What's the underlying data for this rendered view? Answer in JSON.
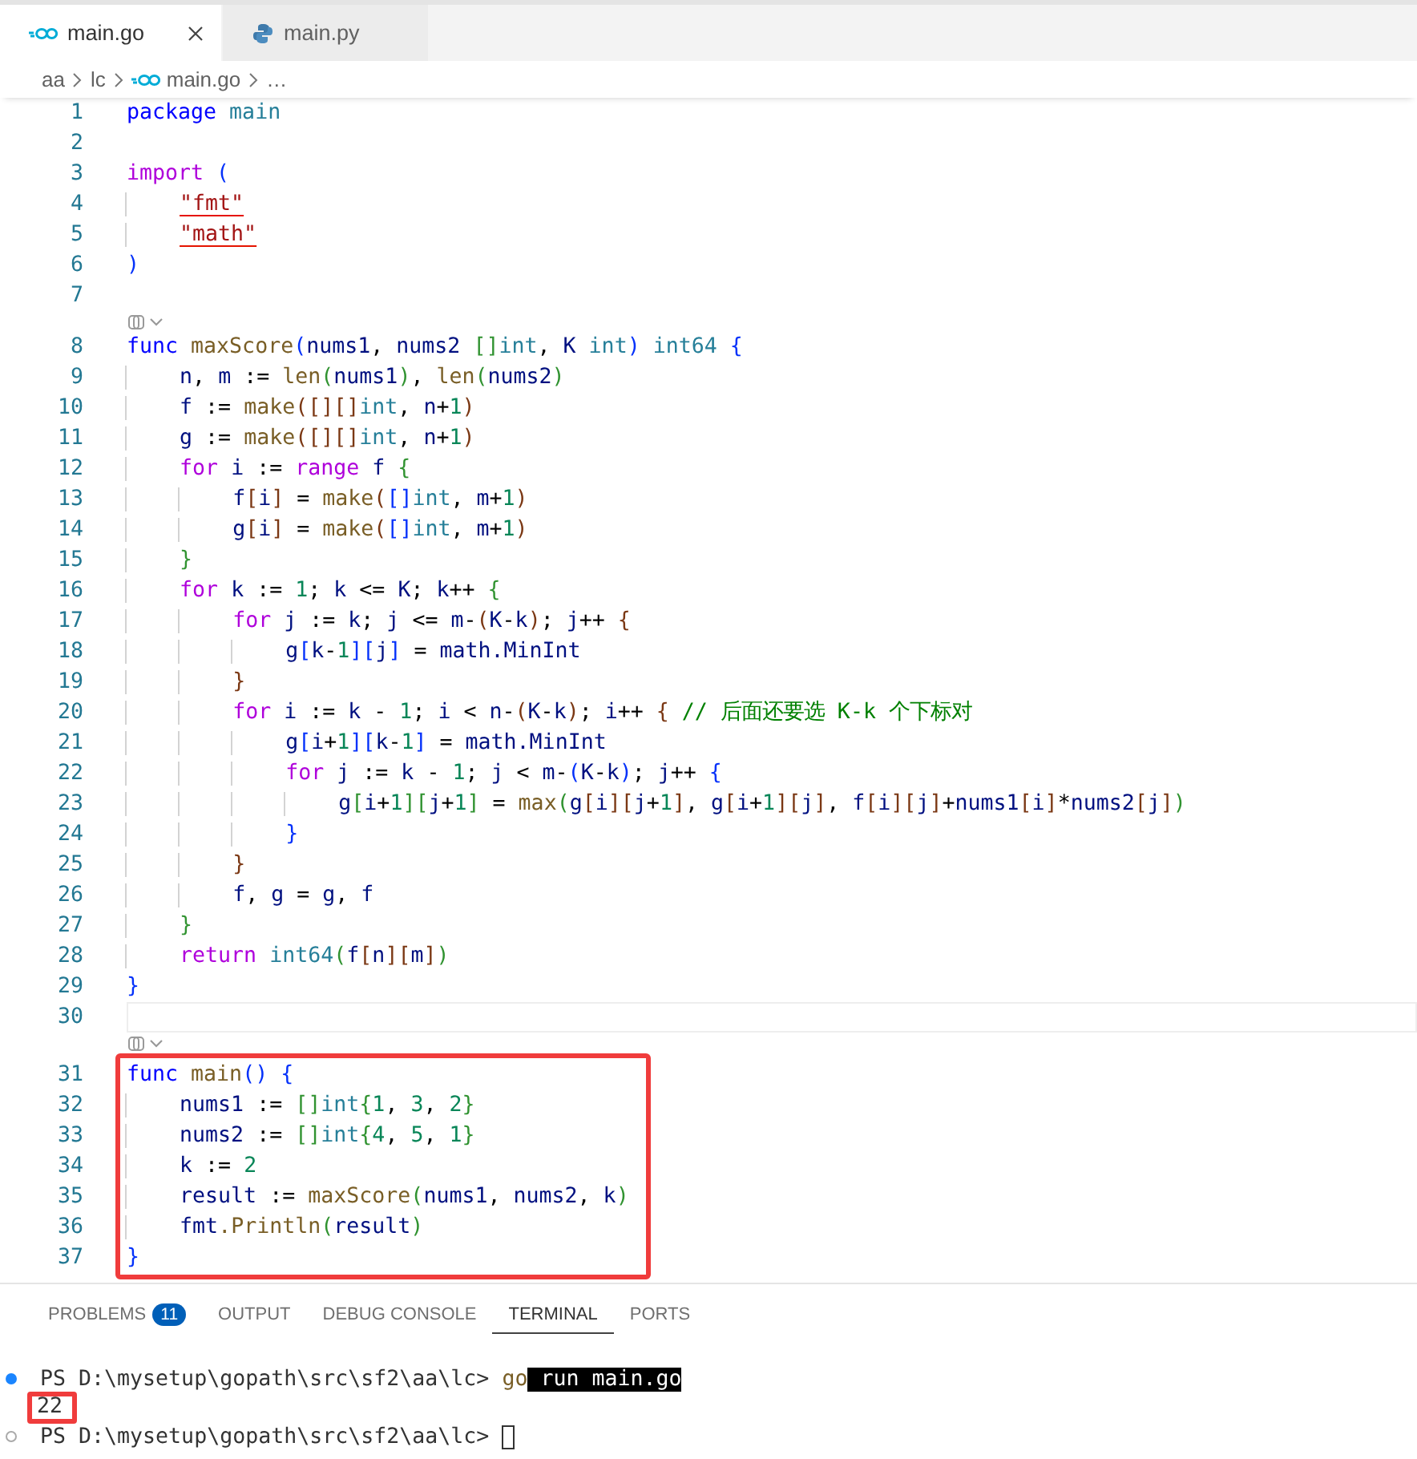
{
  "tabs": [
    {
      "label": "main.go",
      "selected": true,
      "kind": "go"
    },
    {
      "label": "main.py",
      "selected": false,
      "kind": "python"
    }
  ],
  "breadcrumb": [
    {
      "text": "aa",
      "kind": "folder"
    },
    {
      "text": "lc",
      "kind": "folder"
    },
    {
      "text": "main.go",
      "kind": "go"
    },
    {
      "text": "…",
      "kind": "more"
    }
  ],
  "editor": {
    "lines": [
      {
        "kind": "code",
        "number": "1",
        "tokens": [
          {
            "kind": "kw",
            "text": "package"
          },
          {
            "kind": "type",
            "text": " main"
          }
        ]
      },
      {
        "kind": "code",
        "number": "2"
      },
      {
        "kind": "code",
        "number": "3",
        "tokens": [
          {
            "kind": "ctrl",
            "text": "import"
          },
          {
            "kind": "b1",
            "text": " ("
          }
        ]
      },
      {
        "kind": "code",
        "number": "4",
        "tokens": [
          {
            "kind": "str",
            "text": "    \"fmt\"",
            "error": true
          }
        ]
      },
      {
        "kind": "code",
        "number": "5",
        "tokens": [
          {
            "kind": "str",
            "text": "    \"math\"",
            "error": true
          }
        ]
      },
      {
        "kind": "code",
        "number": "6",
        "tokens": [
          {
            "kind": "b1",
            "text": ")"
          }
        ]
      },
      {
        "kind": "code",
        "number": "7"
      },
      {
        "kind": "codelens"
      },
      {
        "kind": "code",
        "number": "8",
        "tokens": [
          {
            "kind": "kw",
            "text": "func"
          },
          {
            "kind": "fn",
            "text": " maxScore"
          },
          {
            "kind": "b1",
            "text": "("
          },
          {
            "kind": "var",
            "text": "nums1"
          },
          {
            "kind": "plain",
            "text": ","
          },
          {
            "kind": "var",
            "text": " nums2"
          },
          {
            "kind": "b2",
            "text": " []"
          },
          {
            "kind": "type",
            "text": "int"
          },
          {
            "kind": "plain",
            "text": ","
          },
          {
            "kind": "var",
            "text": " K"
          },
          {
            "kind": "type",
            "text": " int"
          },
          {
            "kind": "b1",
            "text": ")"
          },
          {
            "kind": "type",
            "text": " int64"
          },
          {
            "kind": "b1",
            "text": " {"
          }
        ]
      },
      {
        "kind": "code",
        "number": "9",
        "tokens": [
          {
            "kind": "var",
            "text": "    n"
          },
          {
            "kind": "plain",
            "text": ","
          },
          {
            "kind": "var",
            "text": " m"
          },
          {
            "kind": "plain",
            "text": " :="
          },
          {
            "kind": "fn",
            "text": " len"
          },
          {
            "kind": "b2",
            "text": "("
          },
          {
            "kind": "var",
            "text": "nums1"
          },
          {
            "kind": "b2",
            "text": ")"
          },
          {
            "kind": "plain",
            "text": ","
          },
          {
            "kind": "fn",
            "text": " len"
          },
          {
            "kind": "b2",
            "text": "("
          },
          {
            "kind": "var",
            "text": "nums2"
          },
          {
            "kind": "b2",
            "text": ")"
          }
        ]
      },
      {
        "kind": "code",
        "number": "10",
        "tokens": [
          {
            "kind": "var",
            "text": "    f"
          },
          {
            "kind": "plain",
            "text": " :="
          },
          {
            "kind": "fn",
            "text": " make"
          },
          {
            "kind": "b3",
            "text": "([][]"
          },
          {
            "kind": "type",
            "text": "int"
          },
          {
            "kind": "plain",
            "text": ","
          },
          {
            "kind": "var",
            "text": " n"
          },
          {
            "kind": "plain",
            "text": "+"
          },
          {
            "kind": "num",
            "text": "1"
          },
          {
            "kind": "b3",
            "text": ")"
          }
        ]
      },
      {
        "kind": "code",
        "number": "11",
        "tokens": [
          {
            "kind": "var",
            "text": "    g"
          },
          {
            "kind": "plain",
            "text": " :="
          },
          {
            "kind": "fn",
            "text": " make"
          },
          {
            "kind": "b3",
            "text": "([][]"
          },
          {
            "kind": "type",
            "text": "int"
          },
          {
            "kind": "plain",
            "text": ","
          },
          {
            "kind": "var",
            "text": " n"
          },
          {
            "kind": "plain",
            "text": "+"
          },
          {
            "kind": "num",
            "text": "1"
          },
          {
            "kind": "b3",
            "text": ")"
          }
        ]
      },
      {
        "kind": "code",
        "number": "12",
        "tokens": [
          {
            "kind": "ctrl",
            "text": "    for"
          },
          {
            "kind": "var",
            "text": " i"
          },
          {
            "kind": "plain",
            "text": " :="
          },
          {
            "kind": "ctrl",
            "text": " range"
          },
          {
            "kind": "var",
            "text": " f"
          },
          {
            "kind": "b2",
            "text": " {"
          }
        ]
      },
      {
        "kind": "code",
        "number": "13",
        "tokens": [
          {
            "kind": "var",
            "text": "        f"
          },
          {
            "kind": "b3",
            "text": "["
          },
          {
            "kind": "var",
            "text": "i"
          },
          {
            "kind": "b3",
            "text": "]"
          },
          {
            "kind": "plain",
            "text": " ="
          },
          {
            "kind": "fn",
            "text": " make"
          },
          {
            "kind": "b3",
            "text": "("
          },
          {
            "kind": "b1",
            "text": "[]"
          },
          {
            "kind": "type",
            "text": "int"
          },
          {
            "kind": "plain",
            "text": ","
          },
          {
            "kind": "var",
            "text": " m"
          },
          {
            "kind": "plain",
            "text": "+"
          },
          {
            "kind": "num",
            "text": "1"
          },
          {
            "kind": "b3",
            "text": ")"
          }
        ]
      },
      {
        "kind": "code",
        "number": "14",
        "tokens": [
          {
            "kind": "var",
            "text": "        g"
          },
          {
            "kind": "b3",
            "text": "["
          },
          {
            "kind": "var",
            "text": "i"
          },
          {
            "kind": "b3",
            "text": "]"
          },
          {
            "kind": "plain",
            "text": " ="
          },
          {
            "kind": "fn",
            "text": " make"
          },
          {
            "kind": "b3",
            "text": "("
          },
          {
            "kind": "b1",
            "text": "[]"
          },
          {
            "kind": "type",
            "text": "int"
          },
          {
            "kind": "plain",
            "text": ","
          },
          {
            "kind": "var",
            "text": " m"
          },
          {
            "kind": "plain",
            "text": "+"
          },
          {
            "kind": "num",
            "text": "1"
          },
          {
            "kind": "b3",
            "text": ")"
          }
        ]
      },
      {
        "kind": "code",
        "number": "15",
        "tokens": [
          {
            "kind": "b2",
            "text": "    }"
          }
        ]
      },
      {
        "kind": "code",
        "number": "16",
        "tokens": [
          {
            "kind": "ctrl",
            "text": "    for"
          },
          {
            "kind": "var",
            "text": " k"
          },
          {
            "kind": "plain",
            "text": " :="
          },
          {
            "kind": "num",
            "text": " 1"
          },
          {
            "kind": "plain",
            "text": ";"
          },
          {
            "kind": "var",
            "text": " k"
          },
          {
            "kind": "plain",
            "text": " <="
          },
          {
            "kind": "var",
            "text": " K"
          },
          {
            "kind": "plain",
            "text": ";"
          },
          {
            "kind": "var",
            "text": " k"
          },
          {
            "kind": "plain",
            "text": "++"
          },
          {
            "kind": "b2",
            "text": " {"
          }
        ]
      },
      {
        "kind": "code",
        "number": "17",
        "tokens": [
          {
            "kind": "ctrl",
            "text": "        for"
          },
          {
            "kind": "var",
            "text": " j"
          },
          {
            "kind": "plain",
            "text": " :="
          },
          {
            "kind": "var",
            "text": " k"
          },
          {
            "kind": "plain",
            "text": ";"
          },
          {
            "kind": "var",
            "text": " j"
          },
          {
            "kind": "plain",
            "text": " <="
          },
          {
            "kind": "var",
            "text": " m"
          },
          {
            "kind": "plain",
            "text": "-"
          },
          {
            "kind": "b3",
            "text": "("
          },
          {
            "kind": "var",
            "text": "K"
          },
          {
            "kind": "plain",
            "text": "-"
          },
          {
            "kind": "var",
            "text": "k"
          },
          {
            "kind": "b3",
            "text": ")"
          },
          {
            "kind": "plain",
            "text": ";"
          },
          {
            "kind": "var",
            "text": " j"
          },
          {
            "kind": "plain",
            "text": "++"
          },
          {
            "kind": "b3",
            "text": " {"
          }
        ]
      },
      {
        "kind": "code",
        "number": "18",
        "tokens": [
          {
            "kind": "var",
            "text": "            g"
          },
          {
            "kind": "b1",
            "text": "["
          },
          {
            "kind": "var",
            "text": "k"
          },
          {
            "kind": "plain",
            "text": "-"
          },
          {
            "kind": "num",
            "text": "1"
          },
          {
            "kind": "b1",
            "text": "]["
          },
          {
            "kind": "var",
            "text": "j"
          },
          {
            "kind": "b1",
            "text": "]"
          },
          {
            "kind": "plain",
            "text": " ="
          },
          {
            "kind": "var",
            "text": " math"
          },
          {
            "kind": "var",
            "text": ".MinInt"
          }
        ]
      },
      {
        "kind": "code",
        "number": "19",
        "tokens": [
          {
            "kind": "b3",
            "text": "        }"
          }
        ]
      },
      {
        "kind": "code",
        "number": "20",
        "tokens": [
          {
            "kind": "ctrl",
            "text": "        for"
          },
          {
            "kind": "var",
            "text": " i"
          },
          {
            "kind": "plain",
            "text": " :="
          },
          {
            "kind": "var",
            "text": " k"
          },
          {
            "kind": "plain",
            "text": " -"
          },
          {
            "kind": "num",
            "text": " 1"
          },
          {
            "kind": "plain",
            "text": ";"
          },
          {
            "kind": "var",
            "text": " i"
          },
          {
            "kind": "plain",
            "text": " <"
          },
          {
            "kind": "var",
            "text": " n"
          },
          {
            "kind": "plain",
            "text": "-"
          },
          {
            "kind": "b3",
            "text": "("
          },
          {
            "kind": "var",
            "text": "K"
          },
          {
            "kind": "plain",
            "text": "-"
          },
          {
            "kind": "var",
            "text": "k"
          },
          {
            "kind": "b3",
            "text": ")"
          },
          {
            "kind": "plain",
            "text": ";"
          },
          {
            "kind": "var",
            "text": " i"
          },
          {
            "kind": "plain",
            "text": "++"
          },
          {
            "kind": "b3",
            "text": " {"
          },
          {
            "kind": "comment",
            "text": " // 后面还要选 K-k 个下标对"
          }
        ]
      },
      {
        "kind": "code",
        "number": "21",
        "tokens": [
          {
            "kind": "var",
            "text": "            g"
          },
          {
            "kind": "b1",
            "text": "["
          },
          {
            "kind": "var",
            "text": "i"
          },
          {
            "kind": "plain",
            "text": "+"
          },
          {
            "kind": "num",
            "text": "1"
          },
          {
            "kind": "b1",
            "text": "]["
          },
          {
            "kind": "var",
            "text": "k"
          },
          {
            "kind": "plain",
            "text": "-"
          },
          {
            "kind": "num",
            "text": "1"
          },
          {
            "kind": "b1",
            "text": "]"
          },
          {
            "kind": "plain",
            "text": " ="
          },
          {
            "kind": "var",
            "text": " math"
          },
          {
            "kind": "var",
            "text": ".MinInt"
          }
        ]
      },
      {
        "kind": "code",
        "number": "22",
        "tokens": [
          {
            "kind": "ctrl",
            "text": "            for"
          },
          {
            "kind": "var",
            "text": " j"
          },
          {
            "kind": "plain",
            "text": " :="
          },
          {
            "kind": "var",
            "text": " k"
          },
          {
            "kind": "plain",
            "text": " -"
          },
          {
            "kind": "num",
            "text": " 1"
          },
          {
            "kind": "plain",
            "text": ";"
          },
          {
            "kind": "var",
            "text": " j"
          },
          {
            "kind": "plain",
            "text": " <"
          },
          {
            "kind": "var",
            "text": " m"
          },
          {
            "kind": "plain",
            "text": "-"
          },
          {
            "kind": "b1",
            "text": "("
          },
          {
            "kind": "var",
            "text": "K"
          },
          {
            "kind": "plain",
            "text": "-"
          },
          {
            "kind": "var",
            "text": "k"
          },
          {
            "kind": "b1",
            "text": ")"
          },
          {
            "kind": "plain",
            "text": ";"
          },
          {
            "kind": "var",
            "text": " j"
          },
          {
            "kind": "plain",
            "text": "++"
          },
          {
            "kind": "b1",
            "text": " {"
          }
        ]
      },
      {
        "kind": "code",
        "number": "23",
        "tokens": [
          {
            "kind": "var",
            "text": "                g"
          },
          {
            "kind": "b2",
            "text": "["
          },
          {
            "kind": "var",
            "text": "i"
          },
          {
            "kind": "plain",
            "text": "+"
          },
          {
            "kind": "num",
            "text": "1"
          },
          {
            "kind": "b2",
            "text": "]["
          },
          {
            "kind": "var",
            "text": "j"
          },
          {
            "kind": "plain",
            "text": "+"
          },
          {
            "kind": "num",
            "text": "1"
          },
          {
            "kind": "b2",
            "text": "]"
          },
          {
            "kind": "plain",
            "text": " ="
          },
          {
            "kind": "fn",
            "text": " max"
          },
          {
            "kind": "b2",
            "text": "("
          },
          {
            "kind": "var",
            "text": "g"
          },
          {
            "kind": "b3",
            "text": "["
          },
          {
            "kind": "var",
            "text": "i"
          },
          {
            "kind": "b3",
            "text": "]["
          },
          {
            "kind": "var",
            "text": "j"
          },
          {
            "kind": "plain",
            "text": "+"
          },
          {
            "kind": "num",
            "text": "1"
          },
          {
            "kind": "b3",
            "text": "]"
          },
          {
            "kind": "plain",
            "text": ","
          },
          {
            "kind": "var",
            "text": " g"
          },
          {
            "kind": "b3",
            "text": "["
          },
          {
            "kind": "var",
            "text": "i"
          },
          {
            "kind": "plain",
            "text": "+"
          },
          {
            "kind": "num",
            "text": "1"
          },
          {
            "kind": "b3",
            "text": "]["
          },
          {
            "kind": "var",
            "text": "j"
          },
          {
            "kind": "b3",
            "text": "]"
          },
          {
            "kind": "plain",
            "text": ","
          },
          {
            "kind": "var",
            "text": " f"
          },
          {
            "kind": "b3",
            "text": "["
          },
          {
            "kind": "var",
            "text": "i"
          },
          {
            "kind": "b3",
            "text": "]["
          },
          {
            "kind": "var",
            "text": "j"
          },
          {
            "kind": "b3",
            "text": "]"
          },
          {
            "kind": "plain",
            "text": "+"
          },
          {
            "kind": "var",
            "text": "nums1"
          },
          {
            "kind": "b3",
            "text": "["
          },
          {
            "kind": "var",
            "text": "i"
          },
          {
            "kind": "b3",
            "text": "]"
          },
          {
            "kind": "plain",
            "text": "*"
          },
          {
            "kind": "var",
            "text": "nums2"
          },
          {
            "kind": "b3",
            "text": "["
          },
          {
            "kind": "var",
            "text": "j"
          },
          {
            "kind": "b3",
            "text": "]"
          },
          {
            "kind": "b2",
            "text": ")"
          }
        ]
      },
      {
        "kind": "code",
        "number": "24",
        "tokens": [
          {
            "kind": "b1",
            "text": "            }"
          }
        ]
      },
      {
        "kind": "code",
        "number": "25",
        "tokens": [
          {
            "kind": "b3",
            "text": "        }"
          }
        ]
      },
      {
        "kind": "code",
        "number": "26",
        "tokens": [
          {
            "kind": "var",
            "text": "        f"
          },
          {
            "kind": "plain",
            "text": ","
          },
          {
            "kind": "var",
            "text": " g"
          },
          {
            "kind": "plain",
            "text": " ="
          },
          {
            "kind": "var",
            "text": " g"
          },
          {
            "kind": "plain",
            "text": ","
          },
          {
            "kind": "var",
            "text": " f"
          }
        ]
      },
      {
        "kind": "code",
        "number": "27",
        "tokens": [
          {
            "kind": "b2",
            "text": "    }"
          }
        ]
      },
      {
        "kind": "code",
        "number": "28",
        "tokens": [
          {
            "kind": "ctrl",
            "text": "    return"
          },
          {
            "kind": "type",
            "text": " int64"
          },
          {
            "kind": "b2",
            "text": "("
          },
          {
            "kind": "var",
            "text": "f"
          },
          {
            "kind": "b3",
            "text": "["
          },
          {
            "kind": "var",
            "text": "n"
          },
          {
            "kind": "b3",
            "text": "]["
          },
          {
            "kind": "var",
            "text": "m"
          },
          {
            "kind": "b3",
            "text": "]"
          },
          {
            "kind": "b2",
            "text": ")"
          }
        ]
      },
      {
        "kind": "code",
        "number": "29",
        "tokens": [
          {
            "kind": "b1",
            "text": "}"
          }
        ]
      },
      {
        "kind": "code",
        "number": "30",
        "selected": true
      },
      {
        "kind": "codelens"
      }
    ],
    "annotated_block": {
      "lines": [
        {
          "number": "31",
          "tokens": [
            {
              "kind": "kw",
              "text": "func"
            },
            {
              "kind": "fn",
              "text": " main"
            },
            {
              "kind": "b1",
              "text": "()"
            },
            {
              "kind": "b1",
              "text": " {"
            }
          ]
        },
        {
          "number": "32",
          "tokens": [
            {
              "kind": "var",
              "text": "    nums1"
            },
            {
              "kind": "plain",
              "text": " :="
            },
            {
              "kind": "b2",
              "text": " []"
            },
            {
              "kind": "type",
              "text": "int"
            },
            {
              "kind": "b2",
              "text": "{"
            },
            {
              "kind": "num",
              "text": "1"
            },
            {
              "kind": "plain",
              "text": ","
            },
            {
              "kind": "num",
              "text": " 3"
            },
            {
              "kind": "plain",
              "text": ","
            },
            {
              "kind": "num",
              "text": " 2"
            },
            {
              "kind": "b2",
              "text": "}"
            }
          ]
        },
        {
          "number": "33",
          "tokens": [
            {
              "kind": "var",
              "text": "    nums2"
            },
            {
              "kind": "plain",
              "text": " :="
            },
            {
              "kind": "b2",
              "text": " []"
            },
            {
              "kind": "type",
              "text": "int"
            },
            {
              "kind": "b2",
              "text": "{"
            },
            {
              "kind": "num",
              "text": "4"
            },
            {
              "kind": "plain",
              "text": ","
            },
            {
              "kind": "num",
              "text": " 5"
            },
            {
              "kind": "plain",
              "text": ","
            },
            {
              "kind": "num",
              "text": " 1"
            },
            {
              "kind": "b2",
              "text": "}"
            }
          ]
        },
        {
          "number": "34",
          "tokens": [
            {
              "kind": "var",
              "text": "    k"
            },
            {
              "kind": "plain",
              "text": " :="
            },
            {
              "kind": "num",
              "text": " 2"
            }
          ]
        },
        {
          "number": "35",
          "tokens": [
            {
              "kind": "var",
              "text": "    result"
            },
            {
              "kind": "plain",
              "text": " :="
            },
            {
              "kind": "fn",
              "text": " maxScore"
            },
            {
              "kind": "b2",
              "text": "("
            },
            {
              "kind": "var",
              "text": "nums1"
            },
            {
              "kind": "plain",
              "text": ","
            },
            {
              "kind": "var",
              "text": " nums2"
            },
            {
              "kind": "plain",
              "text": ","
            },
            {
              "kind": "var",
              "text": " k"
            },
            {
              "kind": "b2",
              "text": ")"
            }
          ]
        },
        {
          "number": "36",
          "tokens": [
            {
              "kind": "var",
              "text": "    fmt"
            },
            {
              "kind": "fn",
              "text": ".Println"
            },
            {
              "kind": "b2",
              "text": "("
            },
            {
              "kind": "var",
              "text": "result"
            },
            {
              "kind": "b2",
              "text": ")"
            }
          ]
        },
        {
          "number": "37",
          "tokens": [
            {
              "kind": "b1",
              "text": "}"
            }
          ]
        }
      ]
    }
  },
  "panel": {
    "tabs": [
      {
        "label": "PROBLEMS",
        "badge": "11",
        "selected": false
      },
      {
        "label": "OUTPUT",
        "selected": false
      },
      {
        "label": "DEBUG CONSOLE",
        "selected": false
      },
      {
        "label": "TERMINAL",
        "selected": true
      },
      {
        "label": "PORTS",
        "selected": false
      }
    ],
    "terminal": [
      {
        "kind": "finished-command",
        "tokens": [
          {
            "kind": "prompt",
            "text": "PS D:\\mysetup\\gopath\\src\\sf2\\aa\\lc> "
          },
          {
            "kind": "command",
            "text": "go"
          },
          {
            "kind": "selection",
            "text": " run main.go"
          }
        ]
      },
      {
        "kind": "output",
        "boxed": true,
        "tokens": [
          {
            "kind": "output",
            "text": "22"
          }
        ]
      },
      {
        "kind": "pending-command",
        "cursor": true,
        "tokens": [
          {
            "kind": "prompt",
            "text": "PS D:\\mysetup\\gopath\\src\\sf2\\aa\\lc> "
          }
        ]
      }
    ]
  }
}
